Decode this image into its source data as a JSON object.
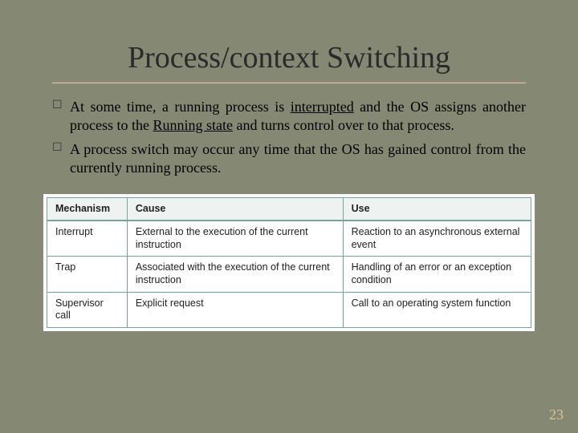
{
  "title": "Process/context Switching",
  "bullets": [
    {
      "pre": "At some time, a running process is ",
      "u1": "interrupted",
      "mid": " and the OS assigns another process to the ",
      "u2": "Running state",
      "post": " and turns control over to that process."
    },
    {
      "pre": "A process switch may occur any time that the OS has gained control from the currently running process.",
      "u1": "",
      "mid": "",
      "u2": "",
      "post": ""
    }
  ],
  "table": {
    "headers": [
      "Mechanism",
      "Cause",
      "Use"
    ],
    "rows": [
      [
        "Interrupt",
        "External to the execution of the current instruction",
        "Reaction to an asynchronous external event"
      ],
      [
        "Trap",
        "Associated with the execution of the current instruction",
        "Handling of an error or an exception condition"
      ],
      [
        "Supervisor call",
        "Explicit request",
        "Call to an operating system function"
      ]
    ]
  },
  "page_number": "23"
}
